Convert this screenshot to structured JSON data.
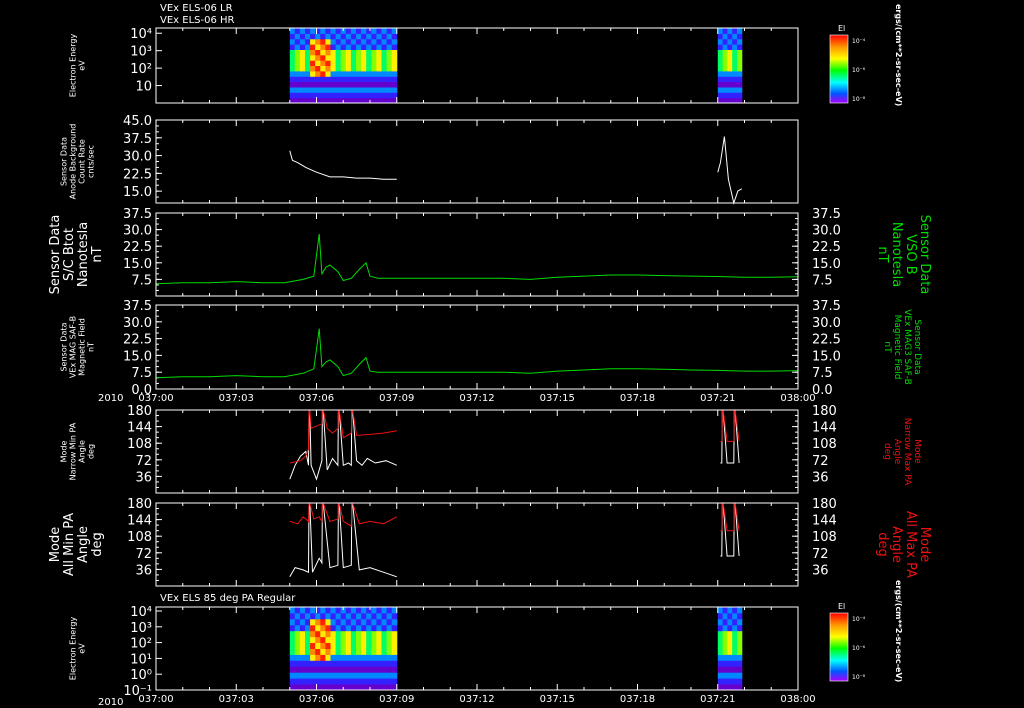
{
  "title_lines": [
    "VEx ELS-06 LR",
    "VEx ELS-06 HR"
  ],
  "panel7_title": "VEx ELS 85 deg PA Regular",
  "colorbar": {
    "title": "El",
    "ticks": [
      "10⁻⁴",
      "10⁻⁶",
      "10⁻⁸"
    ],
    "units": "ergs/(cm**2-sr-sec-eV)"
  },
  "time_axis": {
    "year": "2010",
    "ticks": [
      "037:00",
      "037:03",
      "037:06",
      "037:09",
      "037:12",
      "037:15",
      "037:18",
      "037:21",
      "038:00"
    ]
  },
  "colors": {
    "background": "#000000",
    "axes": "#ffffff",
    "green": "#00dd00",
    "red": "#ee1111",
    "white_trace": "#ffffff"
  },
  "chart_data": [
    {
      "type": "heatmap",
      "title": "VEx ELS-06 LR / VEx ELS-06 HR",
      "ylabel": [
        "Electron Energy",
        "eV"
      ],
      "yscale": "log",
      "yticks": [
        "10",
        "10²",
        "10³",
        "10⁴"
      ],
      "data_intervals": [
        [
          "037:05.0",
          "037:09.0"
        ],
        [
          "037:21.0",
          "037:21.9"
        ]
      ]
    },
    {
      "type": "line",
      "ylabel": [
        "Sensor Data",
        "Anode Background",
        "Count Rate",
        "cnts/sec"
      ],
      "ylim": [
        10,
        45
      ],
      "yticks": [
        "15.0",
        "22.5",
        "30.0",
        "37.5",
        "45.0"
      ],
      "series": [
        {
          "color": "white",
          "x": [
            5.0,
            5.1,
            5.3,
            5.6,
            6.0,
            6.5,
            7.0,
            7.5,
            8.0,
            8.5,
            9.0
          ],
          "y": [
            32,
            28,
            27,
            25,
            23,
            21,
            21,
            20.5,
            20.5,
            20,
            20
          ]
        },
        {
          "color": "white",
          "x": [
            21.0,
            21.1,
            21.25,
            21.4,
            21.6,
            21.75,
            21.9
          ],
          "y": [
            23,
            27,
            38,
            20,
            10,
            15,
            16
          ]
        }
      ]
    },
    {
      "type": "line",
      "ylabel_left": [
        "Sensor Data",
        "S/C Btot",
        "Nanotesla",
        "nT"
      ],
      "ylabel_right": [
        "Sensor Data",
        "VSO B",
        "Nanotesla",
        "nT"
      ],
      "ylim": [
        0,
        37.5
      ],
      "yticks": [
        "7.5",
        "15.0",
        "22.5",
        "30.0",
        "37.5"
      ],
      "series": [
        {
          "color": "green",
          "x": [
            0,
            1,
            2,
            3,
            4,
            4.8,
            5.5,
            5.9,
            6.05,
            6.1,
            6.2,
            6.35,
            6.5,
            6.8,
            7.0,
            7.3,
            7.6,
            7.85,
            8.0,
            8.3,
            9,
            10,
            11,
            12,
            13,
            14,
            15,
            16,
            17,
            18,
            19,
            20,
            21,
            22,
            23,
            24
          ],
          "y": [
            5.5,
            6,
            6,
            6.5,
            6,
            6,
            7.5,
            9,
            23,
            28,
            10,
            13,
            14,
            11,
            7,
            8,
            12,
            15,
            9,
            8,
            8,
            8,
            8,
            8,
            8,
            7.5,
            8.5,
            9,
            9.5,
            9.5,
            9.2,
            9,
            8.8,
            8.5,
            8.5,
            8.7
          ]
        }
      ]
    },
    {
      "type": "line",
      "ylabel_left": [
        "Sensor Data",
        "VEx MAG SAF-B",
        "Magnetic Field",
        "nT"
      ],
      "ylabel_right": [
        "Sensor Data",
        "VEx MAG3 SAF-B",
        "Magnetic Field",
        "nT"
      ],
      "ylim": [
        0,
        37.5
      ],
      "yticks": [
        "0.0",
        "7.5",
        "15.0",
        "22.5",
        "30.0",
        "37.5"
      ],
      "series": [
        {
          "color": "green",
          "x": [
            0,
            1,
            2,
            3,
            4,
            4.8,
            5.5,
            5.9,
            6.05,
            6.1,
            6.2,
            6.35,
            6.5,
            6.8,
            7.0,
            7.3,
            7.6,
            7.85,
            8.0,
            8.3,
            9,
            10,
            11,
            12,
            13,
            14,
            15,
            16,
            17,
            18,
            19,
            20,
            21,
            22,
            23,
            24
          ],
          "y": [
            5,
            5.5,
            5.5,
            6,
            5.5,
            5.5,
            7,
            9,
            22,
            27,
            10,
            12,
            13,
            10,
            6,
            7,
            11,
            14,
            8,
            7.5,
            7.5,
            7.5,
            7.5,
            7.5,
            7.5,
            7,
            8,
            8.5,
            9,
            9,
            8.8,
            8.5,
            8.3,
            8,
            8,
            8.2
          ]
        }
      ]
    },
    {
      "type": "line",
      "ylabel_left": [
        "Mode",
        "Narrow Min PA",
        "Angle",
        "deg"
      ],
      "ylabel_right": [
        "Mode",
        "Narrow Max PA",
        "Angle",
        "deg"
      ],
      "ylim": [
        0,
        180
      ],
      "yticks": [
        "36",
        "72",
        "108",
        "144",
        "180"
      ],
      "series": [
        {
          "color": "white",
          "x": [
            5.0,
            5.2,
            5.4,
            5.6,
            5.7,
            5.72,
            5.75,
            5.8,
            6.0,
            6.2,
            6.22,
            6.25,
            6.4,
            6.6,
            6.8,
            6.82,
            6.85,
            7.0,
            7.2,
            7.3,
            7.32,
            7.35,
            7.5,
            7.7,
            7.9,
            8.2,
            8.6,
            9.0
          ],
          "y": [
            30,
            60,
            80,
            90,
            60,
            180,
            180,
            60,
            30,
            70,
            180,
            180,
            50,
            75,
            60,
            180,
            180,
            60,
            65,
            60,
            180,
            180,
            70,
            60,
            75,
            65,
            70,
            60
          ]
        },
        {
          "color": "red",
          "x": [
            5.0,
            5.4,
            5.6,
            5.7,
            5.72,
            5.75,
            5.8,
            6.0,
            6.2,
            6.22,
            6.25,
            6.4,
            6.6,
            6.8,
            6.82,
            6.85,
            7.0,
            7.3,
            7.32,
            7.35,
            7.5,
            8.0,
            8.5,
            9.0
          ],
          "y": [
            65,
            70,
            80,
            95,
            180,
            180,
            140,
            145,
            150,
            180,
            180,
            140,
            130,
            140,
            180,
            180,
            120,
            130,
            180,
            180,
            125,
            127,
            130,
            135
          ]
        },
        {
          "color": "white",
          "x": [
            21.1,
            21.15,
            21.17,
            21.2,
            21.35,
            21.6,
            21.62,
            21.65,
            21.8
          ],
          "y": [
            65,
            65,
            180,
            180,
            65,
            65,
            180,
            180,
            65
          ]
        },
        {
          "color": "red",
          "x": [
            21.1,
            21.15,
            21.17,
            21.2,
            21.35,
            21.6,
            21.62,
            21.65,
            21.8
          ],
          "y": [
            112,
            112,
            180,
            180,
            112,
            112,
            180,
            180,
            112
          ]
        }
      ]
    },
    {
      "type": "line",
      "ylabel_left": [
        "Mode",
        "All Min PA",
        "Angle",
        "deg"
      ],
      "ylabel_right": [
        "Mode",
        "All Max PA",
        "Angle",
        "deg"
      ],
      "ylim": [
        0,
        180
      ],
      "yticks": [
        "36",
        "72",
        "108",
        "144",
        "180"
      ],
      "series": [
        {
          "color": "white",
          "x": [
            5.0,
            5.2,
            5.5,
            5.7,
            5.72,
            5.75,
            5.85,
            6.1,
            6.2,
            6.22,
            6.25,
            6.5,
            6.8,
            6.82,
            6.85,
            7.0,
            7.3,
            7.32,
            7.35,
            7.6,
            8.0,
            8.5,
            9.0
          ],
          "y": [
            20,
            40,
            35,
            30,
            180,
            180,
            30,
            60,
            50,
            180,
            180,
            40,
            45,
            180,
            180,
            40,
            45,
            180,
            180,
            35,
            40,
            30,
            20
          ]
        },
        {
          "color": "red",
          "x": [
            5.0,
            5.3,
            5.5,
            5.7,
            5.72,
            5.75,
            5.9,
            6.1,
            6.2,
            6.22,
            6.25,
            6.5,
            6.8,
            6.82,
            6.85,
            7.0,
            7.3,
            7.32,
            7.35,
            7.6,
            8.0,
            8.5,
            9.0
          ],
          "y": [
            140,
            135,
            150,
            140,
            180,
            180,
            145,
            150,
            140,
            180,
            180,
            140,
            145,
            180,
            180,
            140,
            130,
            180,
            180,
            135,
            140,
            135,
            150
          ]
        },
        {
          "color": "white",
          "x": [
            21.1,
            21.15,
            21.17,
            21.2,
            21.35,
            21.6,
            21.62,
            21.65,
            21.8
          ],
          "y": [
            65,
            65,
            180,
            180,
            65,
            65,
            180,
            180,
            65
          ]
        },
        {
          "color": "red",
          "x": [
            21.1,
            21.15,
            21.17,
            21.2,
            21.35,
            21.6,
            21.62,
            21.65,
            21.8
          ],
          "y": [
            120,
            120,
            180,
            180,
            120,
            120,
            180,
            180,
            120
          ]
        }
      ]
    },
    {
      "type": "heatmap",
      "title": "VEx ELS 85 deg PA Regular",
      "ylabel": [
        "Electron Energy",
        "eV"
      ],
      "yscale": "log",
      "yticks": [
        "10⁻¹",
        "10⁰",
        "10¹",
        "10²",
        "10³",
        "10⁴"
      ],
      "data_intervals": [
        [
          "037:05.0",
          "037:09.0"
        ],
        [
          "037:21.0",
          "037:21.9"
        ]
      ]
    }
  ]
}
